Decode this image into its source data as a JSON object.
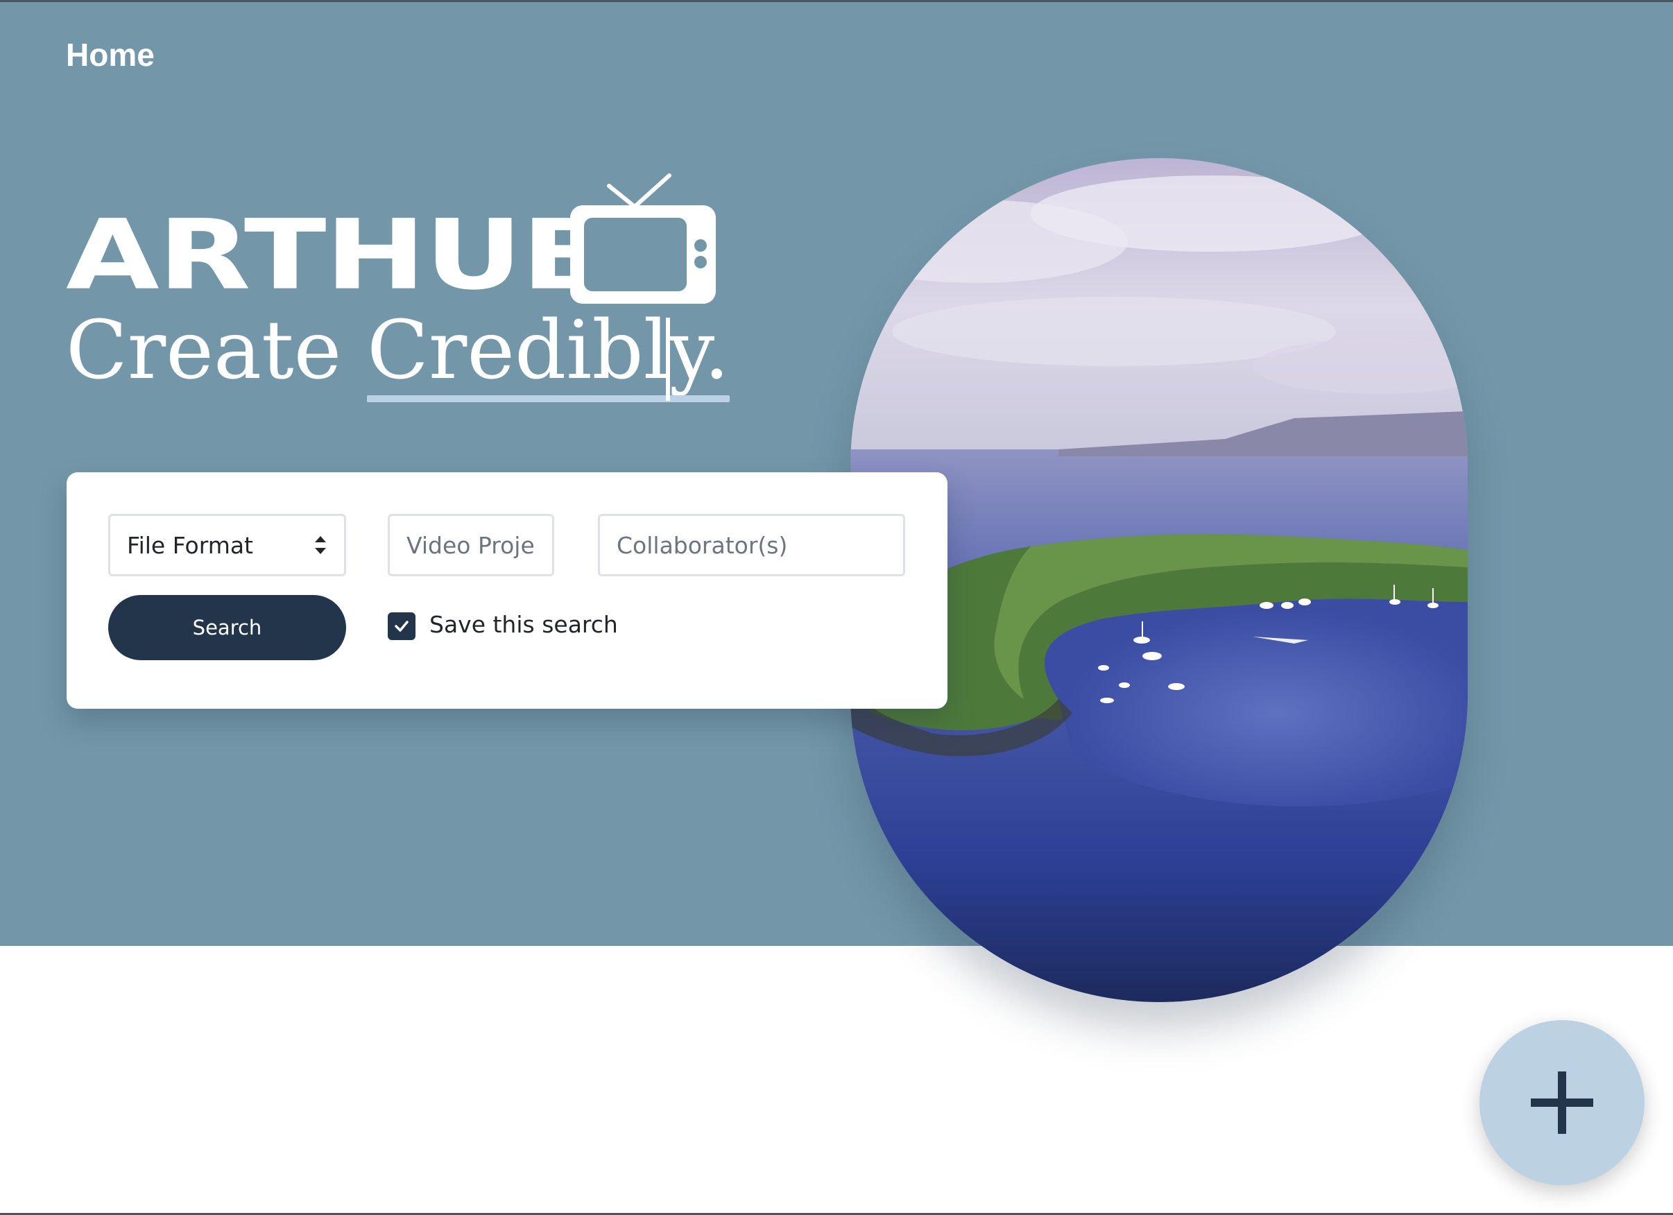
{
  "nav": {
    "home_label": "Home"
  },
  "brand": {
    "logo_text": "ARTHUB",
    "logo_icon": "tv-icon"
  },
  "hero": {
    "tagline_prefix": "Create ",
    "tagline_accent": "Credibly.",
    "image_description_icon": "island-photo"
  },
  "search_form": {
    "file_format": {
      "selected": "File Format"
    },
    "project": {
      "placeholder": "Video Project"
    },
    "collaborators": {
      "placeholder": "Collaborator(s)"
    },
    "search_label": "Search",
    "save_search": {
      "label": "Save this search",
      "checked": true
    }
  },
  "fab": {
    "icon": "plus-icon"
  },
  "colors": {
    "hero_bg": "#7397a9",
    "primary": "#22354b",
    "accent": "#bcd2e2"
  }
}
